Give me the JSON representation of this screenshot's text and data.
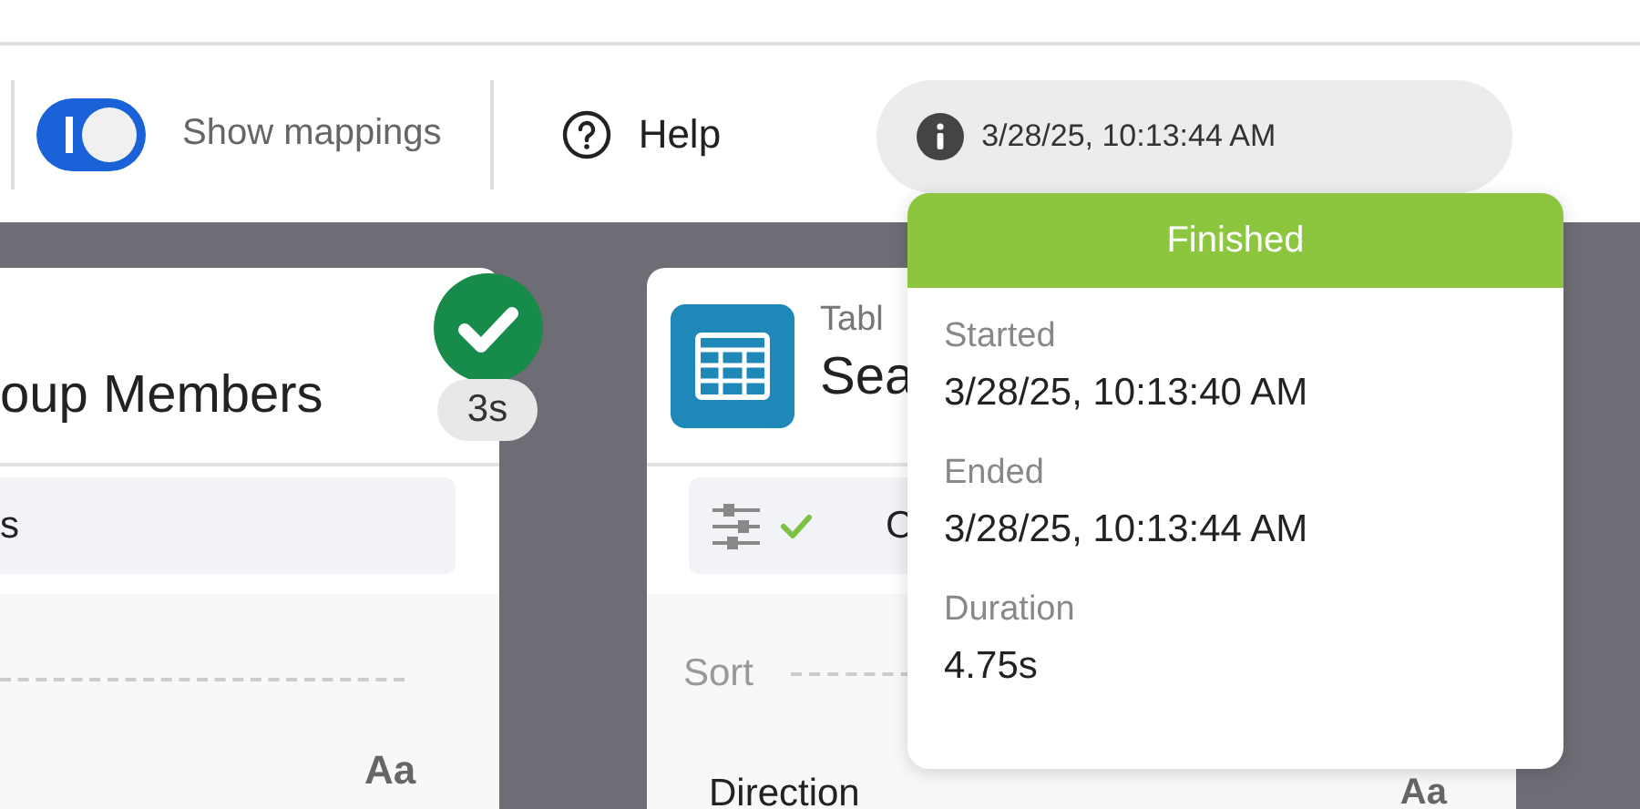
{
  "toolbar": {
    "show_mappings": {
      "label": "Show mappings",
      "on": true
    },
    "help": "Help",
    "status_time": "3/28/25, 10:13:44 AM"
  },
  "popover": {
    "status": "Finished",
    "fields": [
      {
        "label": "Started",
        "value": "3/28/25, 10:13:40 AM"
      },
      {
        "label": "Ended",
        "value": "3/28/25, 10:13:44 AM"
      },
      {
        "label": "Duration",
        "value": "4.75s"
      }
    ]
  },
  "cards": [
    {
      "title": "oup Members",
      "done": true,
      "duration": "3s",
      "field": "s",
      "type_mark": "Aa"
    },
    {
      "kind_label": "Tabl",
      "title": "Sea",
      "settings_ok": true,
      "button": "C",
      "section": "Sort",
      "row_label": "Direction",
      "type_mark": "Aa"
    }
  ]
}
